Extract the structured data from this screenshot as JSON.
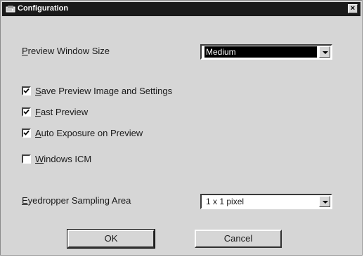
{
  "window": {
    "title": "Configuration",
    "close_glyph": "×"
  },
  "preview_window_size": {
    "label_prefix": "",
    "label_mnemonic": "P",
    "label_rest": "review Window Size",
    "selected": "Medium"
  },
  "options": [
    {
      "mnemonic": "S",
      "rest": "ave Preview Image and Settings",
      "checked": true
    },
    {
      "mnemonic": "F",
      "rest": "ast Preview",
      "checked": true
    },
    {
      "mnemonic": "A",
      "rest": "uto Exposure on Preview",
      "checked": true
    },
    {
      "mnemonic": "W",
      "rest": "indows ICM",
      "checked": false
    }
  ],
  "eyedropper": {
    "label_mnemonic": "E",
    "label_rest": "yedropper Sampling Area",
    "selected": "1 x 1 pixel"
  },
  "buttons": {
    "ok": "OK",
    "cancel": "Cancel"
  },
  "icons": {
    "app": "scanner-app-icon",
    "close": "close-icon",
    "check": "checkmark-icon",
    "dropdown": "chevron-down-icon"
  }
}
